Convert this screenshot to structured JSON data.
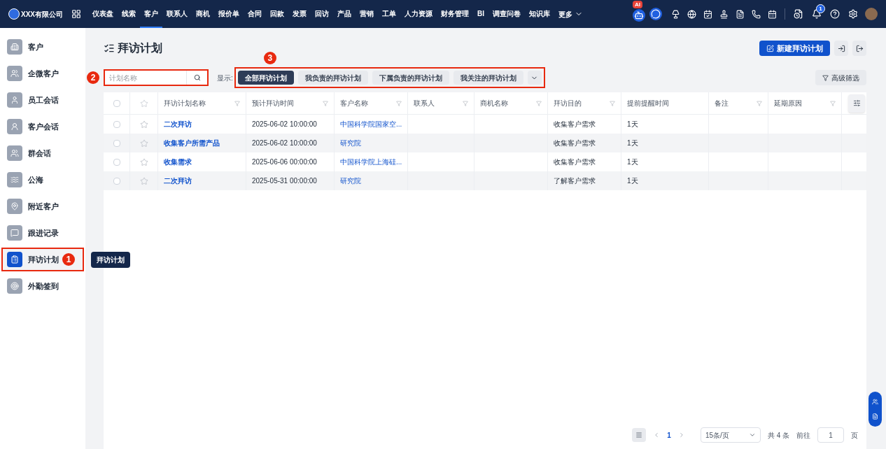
{
  "topbar": {
    "brand": "XXX有限公司",
    "nav": [
      {
        "label": "仪表盘",
        "selected": false
      },
      {
        "label": "线索",
        "selected": false
      },
      {
        "label": "客户",
        "selected": true
      },
      {
        "label": "联系人",
        "selected": false
      },
      {
        "label": "商机",
        "selected": false
      },
      {
        "label": "报价单",
        "selected": false
      },
      {
        "label": "合同",
        "selected": false
      },
      {
        "label": "回款",
        "selected": false
      },
      {
        "label": "发票",
        "selected": false
      },
      {
        "label": "回访",
        "selected": false
      },
      {
        "label": "产品",
        "selected": false
      },
      {
        "label": "营销",
        "selected": false
      },
      {
        "label": "工单",
        "selected": false
      },
      {
        "label": "人力资源",
        "selected": false
      },
      {
        "label": "财务管理",
        "selected": false
      },
      {
        "label": "BI",
        "selected": false
      },
      {
        "label": "调查问卷",
        "selected": false
      },
      {
        "label": "知识库",
        "selected": false
      }
    ],
    "more": "更多",
    "ai_badge": "AI",
    "notification_count": "1"
  },
  "sidebar": {
    "items": [
      {
        "label": "客户",
        "selected": false
      },
      {
        "label": "企微客户",
        "selected": false
      },
      {
        "label": "员工会话",
        "selected": false
      },
      {
        "label": "客户会话",
        "selected": false
      },
      {
        "label": "群会话",
        "selected": false
      },
      {
        "label": "公海",
        "selected": false
      },
      {
        "label": "附近客户",
        "selected": false
      },
      {
        "label": "跟进记录",
        "selected": false
      },
      {
        "label": "拜访计划",
        "selected": true
      },
      {
        "label": "外勤签到",
        "selected": false
      }
    ],
    "tooltip": "拜访计划"
  },
  "page": {
    "title": "拜访计划",
    "new_button": "新建拜访计划",
    "search": {
      "placeholder": "计划名称"
    },
    "show_label": "显示:",
    "filters": [
      {
        "label": "全部拜访计划",
        "selected": true
      },
      {
        "label": "我负责的拜访计划",
        "selected": false
      },
      {
        "label": "下属负责的拜访计划",
        "selected": false
      },
      {
        "label": "我关注的拜访计划",
        "selected": false
      }
    ],
    "advanced_filter": "高级筛选"
  },
  "annotations": [
    "1",
    "2",
    "3"
  ],
  "table": {
    "select_all_checked": false,
    "columns": [
      "拜访计划名称",
      "预计拜访时间",
      "客户名称",
      "联系人",
      "商机名称",
      "拜访目的",
      "提前提醒时间",
      "备注",
      "延期原因"
    ],
    "rows": [
      {
        "checked": false,
        "starred": false,
        "cells": [
          "二次拜访",
          "2025-06-02 10:00:00",
          "中国科学院国家空...",
          "",
          "",
          "收集客户需求",
          "1天",
          "",
          ""
        ]
      },
      {
        "checked": false,
        "starred": false,
        "cells": [
          "收集客户所需产品",
          "2025-06-02 10:00:00",
          "研究院",
          "",
          "",
          "收集客户需求",
          "1天",
          "",
          ""
        ]
      },
      {
        "checked": false,
        "starred": false,
        "cells": [
          "收集需求",
          "2025-06-06 00:00:00",
          "中国科学院上海硅...",
          "",
          "",
          "收集客户需求",
          "1天",
          "",
          ""
        ]
      },
      {
        "checked": false,
        "starred": false,
        "cells": [
          "二次拜访",
          "2025-05-31 00:00:00",
          "研究院",
          "",
          "",
          "了解客户需求",
          "1天",
          "",
          ""
        ]
      }
    ]
  },
  "pagination": {
    "current_page": "1",
    "page_size": "15条/页",
    "total": "共 4 条",
    "goto_label": "前往",
    "goto_value": "1",
    "page_suffix": "页"
  }
}
